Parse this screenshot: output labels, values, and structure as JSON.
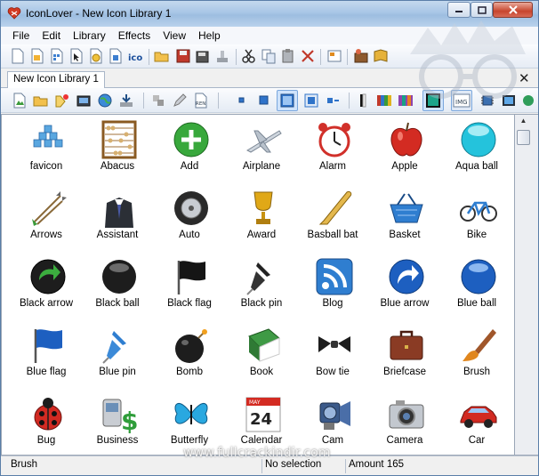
{
  "window": {
    "title": "IconLover - New Icon Library 1"
  },
  "menu": [
    "File",
    "Edit",
    "Library",
    "Effects",
    "View",
    "Help"
  ],
  "toolbar1": [
    "new-icon",
    "open-icon",
    "save-icon",
    "cursor-icon",
    "settings-icon",
    "page-icon",
    "ico-icon",
    "folder-open-icon",
    "save-disk-icon",
    "print-icon",
    "stamp-icon",
    "cut-icon",
    "copy-icon",
    "paste-icon",
    "delete-icon",
    "properties-icon",
    "tools-icon",
    "book-icon"
  ],
  "document_tab": {
    "label": "New Icon Library 1"
  },
  "icons": [
    {
      "label": "favicon",
      "icon": "favicon-icon"
    },
    {
      "label": "Abacus",
      "icon": "abacus-icon"
    },
    {
      "label": "Add",
      "icon": "add-icon"
    },
    {
      "label": "Airplane",
      "icon": "airplane-icon"
    },
    {
      "label": "Alarm",
      "icon": "alarm-icon"
    },
    {
      "label": "Apple",
      "icon": "apple-icon"
    },
    {
      "label": "Aqua ball",
      "icon": "aqua-ball-icon"
    },
    {
      "label": "Arrows",
      "icon": "arrows-icon"
    },
    {
      "label": "Assistant",
      "icon": "assistant-icon"
    },
    {
      "label": "Auto",
      "icon": "auto-icon"
    },
    {
      "label": "Award",
      "icon": "award-icon"
    },
    {
      "label": "Basball bat",
      "icon": "baseball-bat-icon"
    },
    {
      "label": "Basket",
      "icon": "basket-icon"
    },
    {
      "label": "Bike",
      "icon": "bike-icon"
    },
    {
      "label": "Black arrow",
      "icon": "black-arrow-icon"
    },
    {
      "label": "Black ball",
      "icon": "black-ball-icon"
    },
    {
      "label": "Black flag",
      "icon": "black-flag-icon"
    },
    {
      "label": "Black pin",
      "icon": "black-pin-icon"
    },
    {
      "label": "Blog",
      "icon": "blog-icon"
    },
    {
      "label": "Blue arrow",
      "icon": "blue-arrow-icon"
    },
    {
      "label": "Blue ball",
      "icon": "blue-ball-icon"
    },
    {
      "label": "Blue flag",
      "icon": "blue-flag-icon"
    },
    {
      "label": "Blue pin",
      "icon": "blue-pin-icon"
    },
    {
      "label": "Bomb",
      "icon": "bomb-icon"
    },
    {
      "label": "Book",
      "icon": "book-icon"
    },
    {
      "label": "Bow tie",
      "icon": "bow-tie-icon"
    },
    {
      "label": "Briefcase",
      "icon": "briefcase-icon"
    },
    {
      "label": "Brush",
      "icon": "brush-icon"
    },
    {
      "label": "Bug",
      "icon": "bug-icon"
    },
    {
      "label": "Business",
      "icon": "business-icon"
    },
    {
      "label": "Butterfly",
      "icon": "butterfly-icon"
    },
    {
      "label": "Calendar",
      "icon": "calendar-icon"
    },
    {
      "label": "Cam",
      "icon": "cam-icon"
    },
    {
      "label": "Camera",
      "icon": "camera-icon"
    },
    {
      "label": "Car",
      "icon": "car-icon"
    }
  ],
  "calendar_icon_day": "24",
  "calendar_icon_month": "MAY",
  "status": {
    "selected": "Brush",
    "selection": "No selection",
    "amount": "Amount 165"
  },
  "watermark": "www.fullcrackindir.com",
  "colors": {
    "title_bar": "#a9c6e6",
    "close_button": "#c7452d",
    "selected_toolbar_button": "#cfe3fb"
  }
}
